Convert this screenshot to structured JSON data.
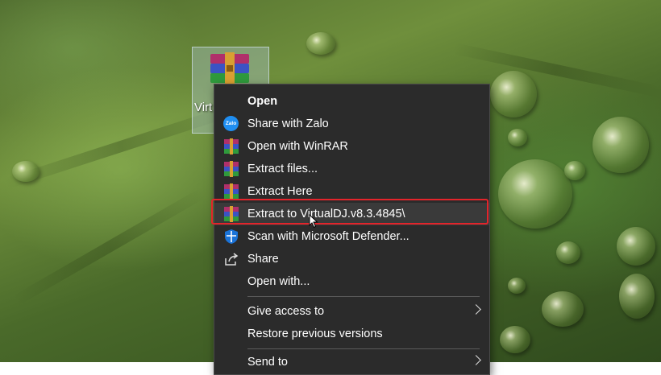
{
  "desktop": {
    "icon_label": "Virt"
  },
  "context_menu": {
    "items": [
      {
        "label": "Open",
        "icon": "none",
        "bold": true
      },
      {
        "label": "Share with Zalo",
        "icon": "zalo-icon",
        "icon_text": "Zalo"
      },
      {
        "label": "Open with WinRAR",
        "icon": "winrar-icon"
      },
      {
        "label": "Extract files...",
        "icon": "winrar-icon"
      },
      {
        "label": "Extract Here",
        "icon": "winrar-icon"
      },
      {
        "label": "Extract to VirtualDJ.v8.3.4845\\",
        "icon": "winrar-icon",
        "highlighted": true
      },
      {
        "label": "Scan with Microsoft Defender...",
        "icon": "defender-shield-icon"
      },
      {
        "label": "Share",
        "icon": "share-icon"
      },
      {
        "label": "Open with...",
        "icon": "none"
      },
      {
        "label": "Give access to",
        "icon": "none",
        "submenu": true
      },
      {
        "label": "Restore previous versions",
        "icon": "none"
      },
      {
        "label": "Send to",
        "icon": "none",
        "submenu": true
      }
    ]
  },
  "colors": {
    "menu_bg": "#2b2b2b",
    "menu_text": "#ffffff",
    "highlight_border": "#e3242b",
    "zalo_blue": "#1f8ef1",
    "defender_blue": "#1a73d9"
  }
}
